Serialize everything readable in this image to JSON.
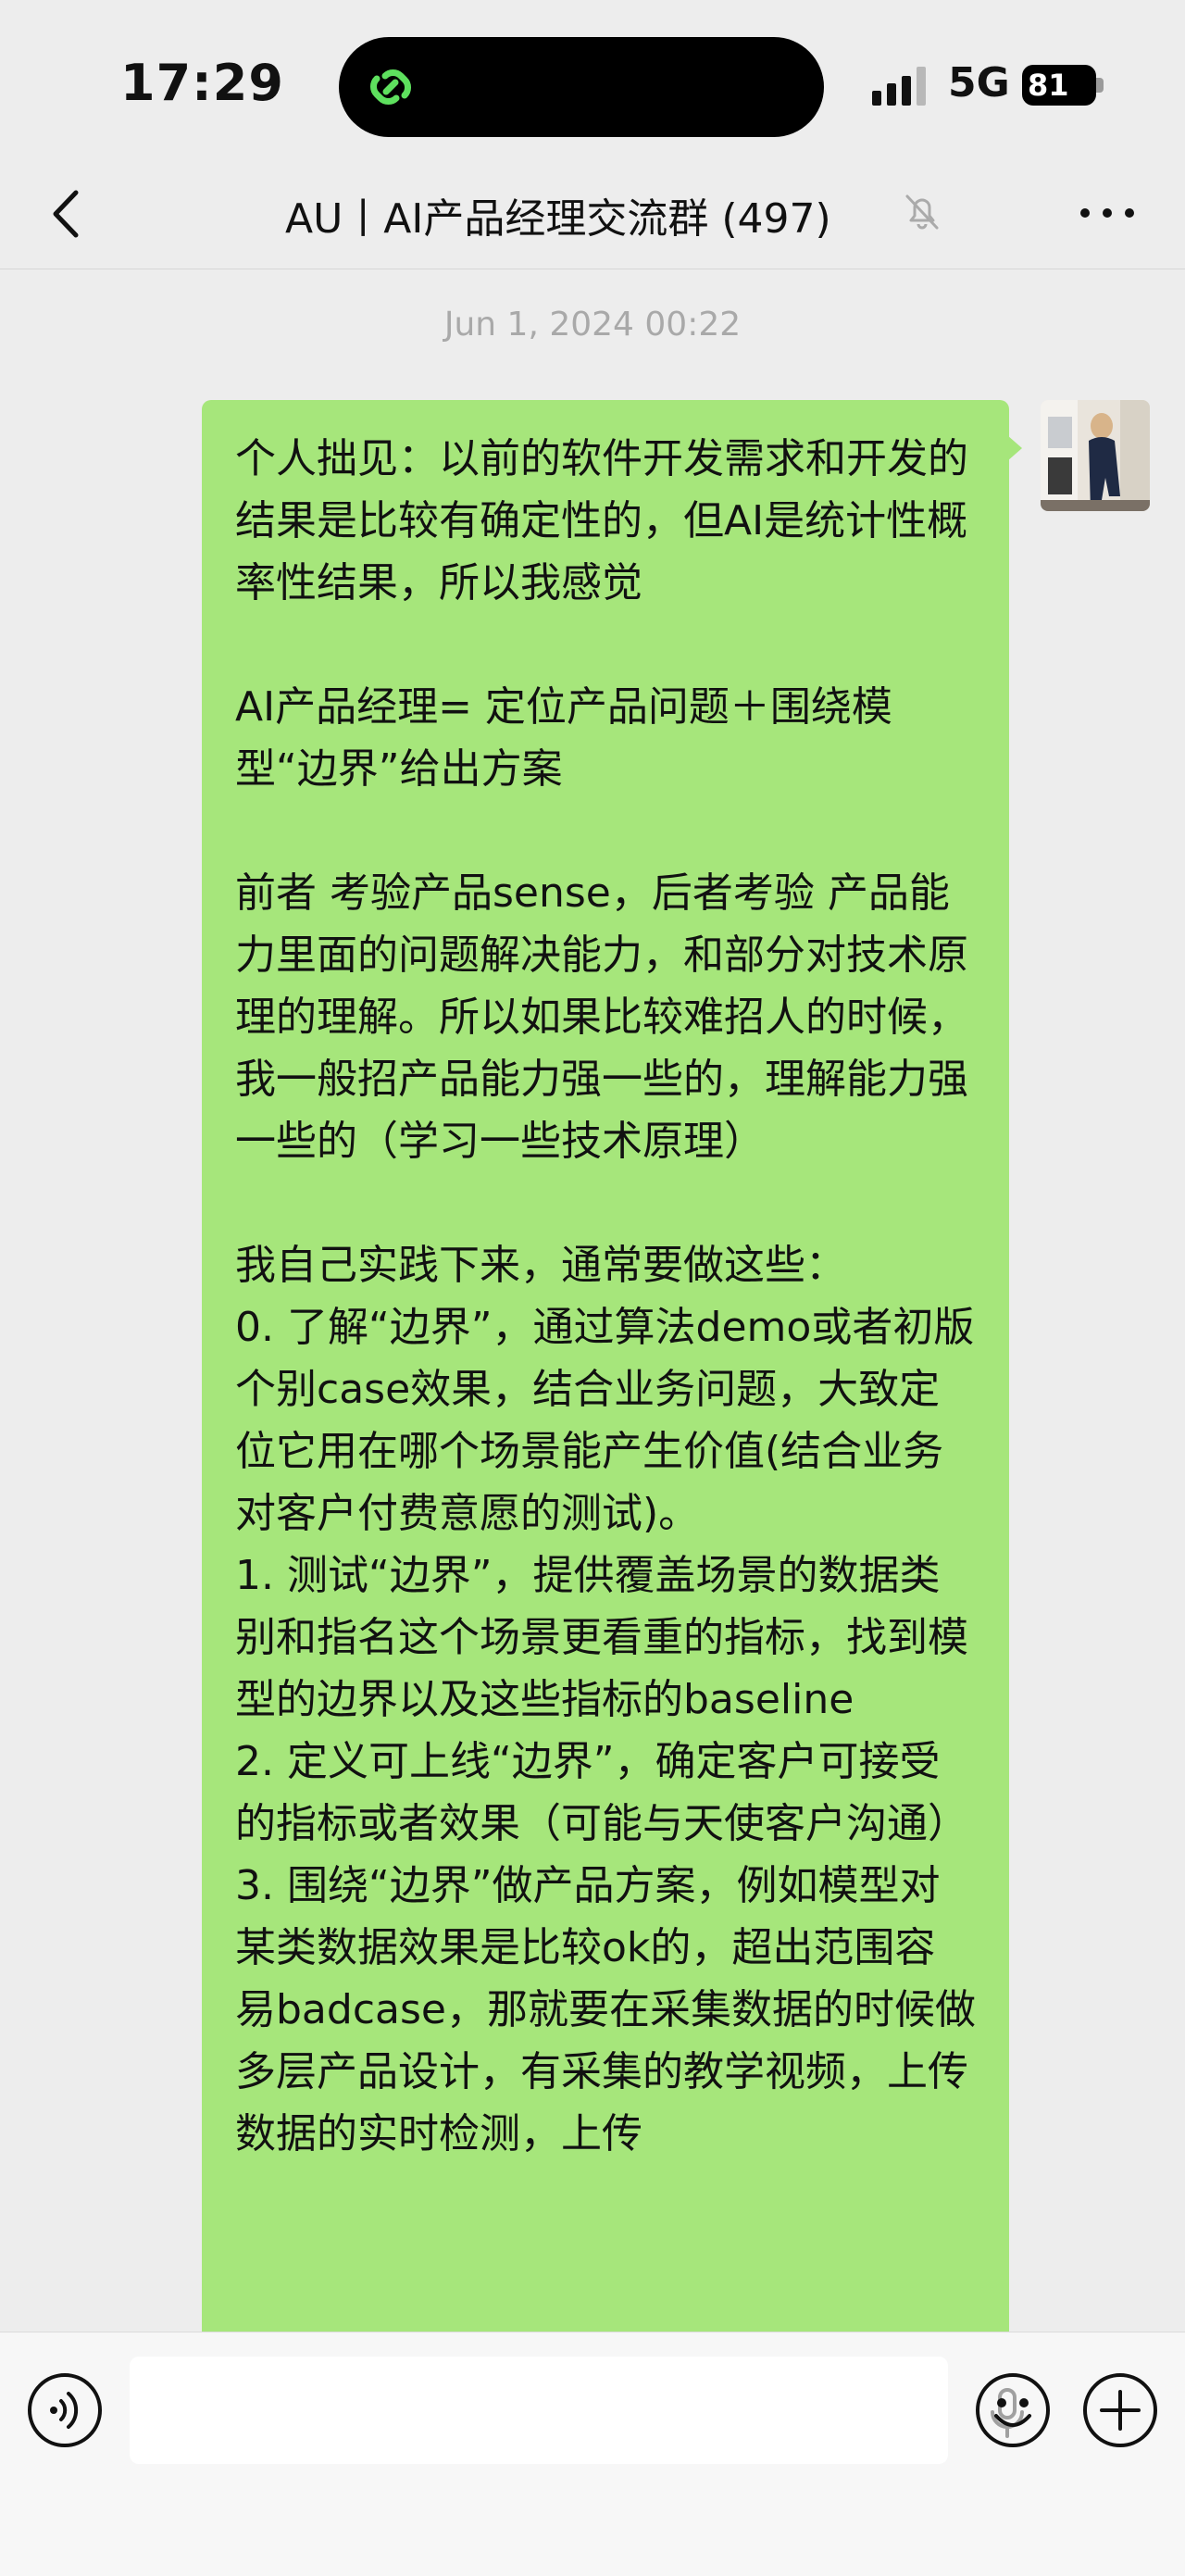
{
  "status_bar": {
    "time": "17:29",
    "network": "5G",
    "battery": "81"
  },
  "nav": {
    "title": "AU丨AI产品经理交流群 (497)"
  },
  "chat": {
    "timestamp": "Jun 1, 2024 00:22",
    "message_paragraphs": [
      "个人拙见：以前的软件开发需求和开发的结果是比较有确定性的，但AI是统计性概率性结果，所以我感觉",
      "AI产品经理= 定位产品问题＋围绕模型“边界”给出方案",
      "前者 考验产品sense，后者考验 产品能力里面的问题解决能力，和部分对技术原理的理解。所以如果比较难招人的时候，我一般招产品能力强一些的，理解能力强一些的（学习一些技术原理）",
      "我自己实践下来，通常要做这些：\n0. 了解“边界”，通过算法demo或者初版个别case效果，结合业务问题，大致定位它用在哪个场景能产生价值(结合业务对客户付费意愿的测试)。\n1. 测试“边界”，提供覆盖场景的数据类别和指名这个场景更看重的指标，找到模型的边界以及这些指标的baseline\n2. 定义可上线“边界”，确定客户可接受的指标或者效果（可能与天使客户沟通）\n3. 围绕“边界”做产品方案，例如模型对某类数据效果是比较ok的，超出范围容易badcase，那就要在采集数据的时候做多层产品设计，有采集的教学视频，上传数据的实时检测，上传"
    ]
  },
  "input_bar": {
    "text_value": ""
  },
  "icons": {
    "back": "chevron-left-icon",
    "mute": "bell-slash-icon",
    "more": "ellipsis-icon",
    "voice": "voice-wave-icon",
    "mic": "microphone-icon",
    "emoji": "smiley-icon",
    "plus": "plus-circle-icon",
    "island": "wechat-link-icon"
  },
  "colors": {
    "bubble": "#a6e67b",
    "background": "#ededed",
    "island_accent": "#5ee05e"
  }
}
